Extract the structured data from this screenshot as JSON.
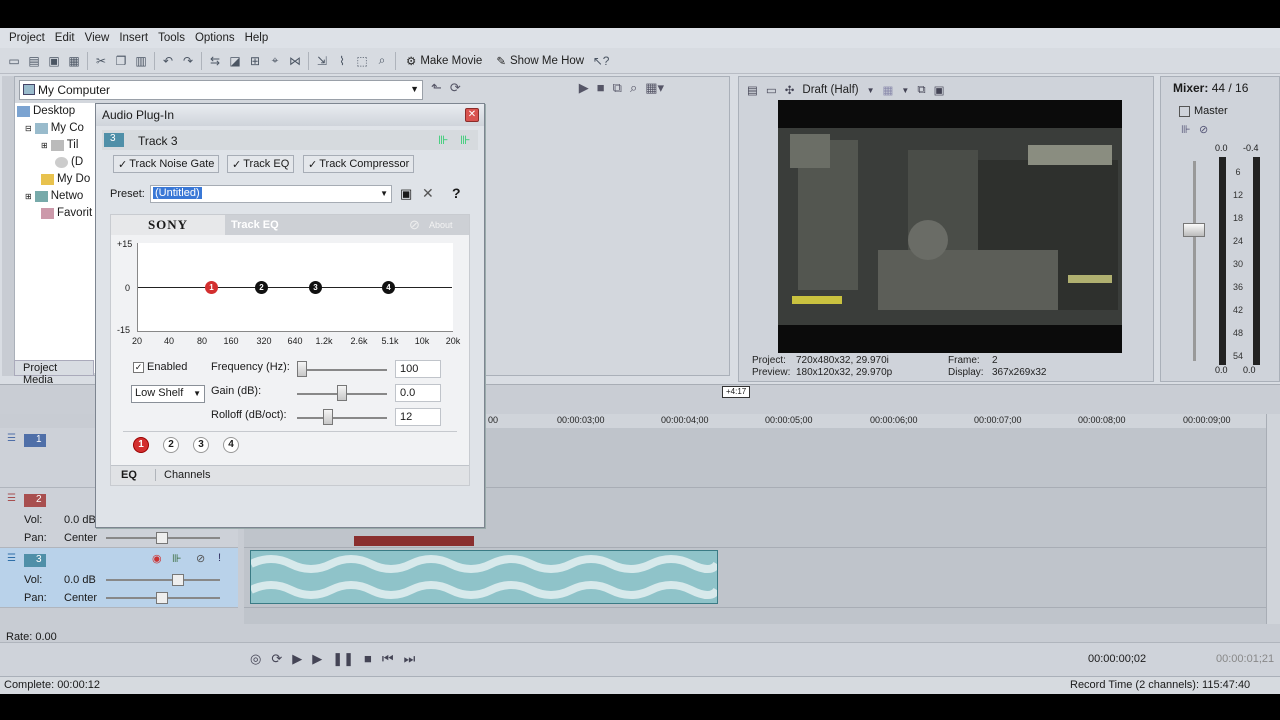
{
  "menu": [
    "Project",
    "Edit",
    "View",
    "Insert",
    "Tools",
    "Options",
    "Help"
  ],
  "toolbar": {
    "make_movie": "Make Movie",
    "show_me_how": "Show Me How"
  },
  "explorer": {
    "location": "My Computer",
    "items": [
      {
        "label": "Desktop"
      },
      {
        "label": "My Co"
      },
      {
        "label": "Til"
      },
      {
        "label": "(D"
      },
      {
        "label": "My Do"
      },
      {
        "label": "Netwo"
      },
      {
        "label": "Favorit"
      }
    ],
    "tab": "Project Media"
  },
  "preview": {
    "quality": "Draft (Half)",
    "project_label": "Project:",
    "project_value": "720x480x32, 29.970i",
    "preview_label": "Preview:",
    "preview_value": "180x120x32, 29.970p",
    "frame_label": "Frame:",
    "frame_value": "2",
    "display_label": "Display:",
    "display_value": "367x269x32"
  },
  "mixer": {
    "title": "Mixer:",
    "count": "44 / 16",
    "master": "Master",
    "peak_left": "0.0",
    "peak_right": "-0.4",
    "scale": [
      "6",
      "12",
      "18",
      "24",
      "30",
      "36",
      "42",
      "48",
      "54"
    ],
    "bottom_left": "0.0",
    "bottom_right": "0.0"
  },
  "timeline": {
    "cursor_marker": "+4:17",
    "timecodes": [
      "00",
      "00:00:03;00",
      "00:00:04;00",
      "00:00:05;00",
      "00:00:06;00",
      "00:00:07;00",
      "00:00:08;00",
      "00:00:09;00"
    ],
    "tracks": [
      {
        "num": "1",
        "color": "#4f6fa8"
      },
      {
        "num": "2",
        "color": "#a84f4f",
        "vol_label": "Vol:",
        "vol": "0.0 dB",
        "pan_label": "Pan:",
        "pan": "Center"
      },
      {
        "num": "3",
        "color": "#4f8fa8",
        "vol_label": "Vol:",
        "vol": "0.0 dB",
        "pan_label": "Pan:",
        "pan": "Center"
      }
    ],
    "rate": "Rate: 0.00",
    "timecode": "00:00:00;02",
    "timecode2": "00:00:01;21"
  },
  "status": {
    "left": "Complete: 00:00:12",
    "right": "Record Time (2 channels): 115:47:40"
  },
  "plugin": {
    "title": "Audio Plug-In",
    "track_num": "3",
    "track_name": "Track 3",
    "chain": [
      "Track Noise Gate",
      "Track EQ",
      "Track Compressor"
    ],
    "preset_label": "Preset:",
    "preset_value": "(Untitled)",
    "brand": "SONY",
    "eq_title": "Track EQ",
    "about": "About",
    "db_top": "+15",
    "db_mid": "0",
    "db_bottom": "-15",
    "hz_labels": [
      "20",
      "40",
      "80",
      "160",
      "320",
      "640",
      "1.2k",
      "2.6k",
      "5.1k",
      "10k",
      "20k"
    ],
    "bands": [
      "1",
      "2",
      "3",
      "4"
    ],
    "enabled_label": "Enabled",
    "filter_type": "Low Shelf",
    "freq_label": "Frequency (Hz):",
    "freq_value": "100",
    "freq_level": 0.0,
    "gain_label": "Gain (dB):",
    "gain_value": "0.0",
    "gain_level": 0.5,
    "rolloff_label": "Rolloff (dB/oct):",
    "rolloff_value": "12",
    "rolloff_level": 0.33,
    "tabs": [
      "EQ",
      "Channels"
    ]
  },
  "colors": {
    "accent": "#d32f2f",
    "audio_clip": "#8fc3c9",
    "selected": "#3a78d6"
  }
}
